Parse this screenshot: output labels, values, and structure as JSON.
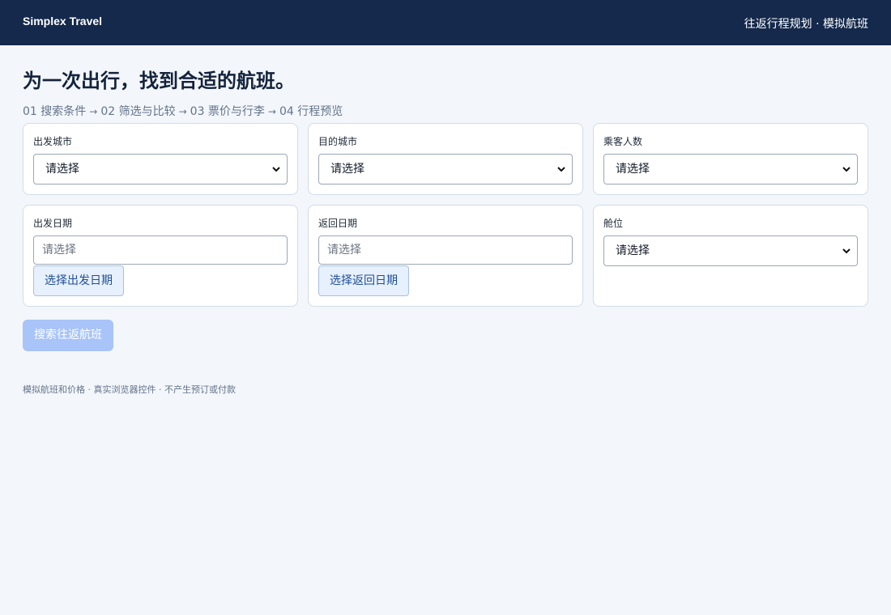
{
  "header": {
    "brand": "Simplex Travel",
    "nav_text": "往返行程规划 · 模拟航班",
    "bg_color": "#14294b"
  },
  "page": {
    "title": "为一次出行，找到合适的航班。"
  },
  "steps": [
    {
      "label": "01 搜索条件"
    },
    {
      "label": "02 筛选与比较"
    },
    {
      "label": "03 票价与行李"
    },
    {
      "label": "04 行程预览"
    }
  ],
  "step_separator": "→",
  "form": {
    "origin": {
      "label": "出发城市",
      "value": "请选择"
    },
    "destination": {
      "label": "目的城市",
      "value": "请选择"
    },
    "passengers": {
      "label": "乘客人数",
      "value": "请选择"
    },
    "depart_date": {
      "label": "出发日期",
      "placeholder": "请选择",
      "button": "选择出发日期"
    },
    "return_date": {
      "label": "返回日期",
      "placeholder": "请选择",
      "button": "选择返回日期"
    },
    "cabin": {
      "label": "舱位",
      "value": "请选择"
    }
  },
  "search_button": {
    "label": "搜索往返航班",
    "color": "#a8c4f8",
    "state": "disabled"
  },
  "footer": {
    "text": "模拟航班和价格 · 真实浏览器控件 · 不产生预订或付款"
  }
}
